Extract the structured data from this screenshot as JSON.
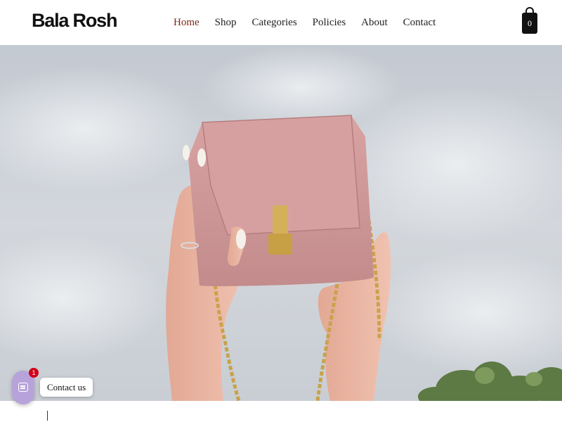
{
  "brand": {
    "name": "Bala Rosh"
  },
  "nav": {
    "items": [
      {
        "label": "Home",
        "active": true
      },
      {
        "label": "Shop",
        "active": false
      },
      {
        "label": "Categories",
        "active": false
      },
      {
        "label": "Policies",
        "active": false
      },
      {
        "label": "About",
        "active": false
      },
      {
        "label": "Contact",
        "active": false
      }
    ],
    "active_color": "#7a2a1a"
  },
  "cart": {
    "count": "0",
    "icon": "shopping-bag-icon"
  },
  "hero": {
    "image": "pink-handbag-held-against-sky"
  },
  "chat_widget": {
    "label": "Contact us",
    "badge_count": "1",
    "icon": "chat-icon",
    "accent": "#b7a3da",
    "badge_color": "#d0021b"
  }
}
